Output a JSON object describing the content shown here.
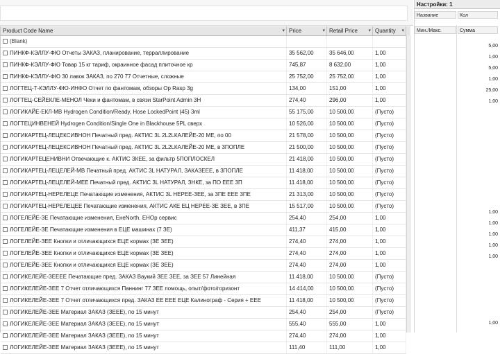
{
  "pivot": {
    "headers": [
      {
        "label": "Product Code Name"
      },
      {
        "label": "Price"
      },
      {
        "label": "Retail Price"
      },
      {
        "label": "Quantity"
      }
    ],
    "rows": [
      {
        "name": "(Blank)",
        "price": "",
        "retail": "",
        "qty": "",
        "group": true
      },
      {
        "name": "ПИНКФ-КЭЛЛУ-ФЮ Отчеты ЗАКАЗ, планирование, терраллирование",
        "price": "35 562,00",
        "retail": "35 646,00",
        "qty": "1,00"
      },
      {
        "name": "ПИНКФ-КЭЛЛУ-ФЮ Товар 15 кг тариф, окраинное фасад плиточное кр",
        "price": "745,87",
        "retail": "8 632,00",
        "qty": "1,00"
      },
      {
        "name": "ПИНКФ-КЭЛЛУ-ФЮ 30 лавок ЗАКАЗ, по 270 77 Отчетные, сложные",
        "price": "25 752,00",
        "retail": "25 752,00",
        "qty": "1,00"
      },
      {
        "name": "ЛОГТЕЦ-Т-КЭЛЛУ-ФЮ-ИНФО Отчет по фантомам, обзоры Op Rasp 3g",
        "price": "134,00",
        "retail": "151,00",
        "qty": "1,00"
      },
      {
        "name": "ЛОГТЕЦ-СЕЙЕКЛЕ-МЕНОЛ Чеки и фантомам, в связи StarPoint Admin 3H",
        "price": "274,40",
        "retail": "296,00",
        "qty": "1,00"
      },
      {
        "name": "ЛОГИКАЙЕ-ЕКЛ-МВ Hydrogen Condition/Ready, Hose LockedPoint (45) 3ml",
        "price": "55 175,00",
        "retail": "10 500,00",
        "qty": "(Пусто)"
      },
      {
        "name": "ЛОГТЕЦИНВЕНЕЙ Hydrogen Condition/Single One in Blackhouse 5PL сверх",
        "price": "10 526,00",
        "retail": "10 500,00",
        "qty": "(Пусто)"
      },
      {
        "name": "ЛОГИКАРТЕЦ-ЛЕЦЕКСИВНОН Печатный пред. АКТИС 3L 2L2LКАЛЕЙЕ-20 МЕ, по 00",
        "price": "21 578,00",
        "retail": "10 500,00",
        "qty": "(Пусто)"
      },
      {
        "name": "ЛОГИКАРТЕЦ-ЛЕЦЕКСИВНОН Печатный пред. АКТИС 3L 2L2LКАЛЕЙЕ-20 МЕ, в 3ПОПЛЕ",
        "price": "21 500,00",
        "retail": "10 500,00",
        "qty": "(Пусто)"
      },
      {
        "name": "ЛОГИКАРТЕЦЕНИВНИ Отвечающие к. АКТИС ЗКЕЕ, за фильтр 5ПОПЛОСКЕЛ",
        "price": "21 418,00",
        "retail": "10 500,00",
        "qty": "(Пусто)"
      },
      {
        "name": "ЛОГИКАРТЕЦ-ЛЕЦЕЛЕЙ-МВ Печатный пред. АКТИС 3L НАТУРАЛ, ЗАКАЗЕЕЕ, в 3ПОПЛЕ",
        "price": "11 418,00",
        "retail": "10 500,00",
        "qty": "(Пусто)"
      },
      {
        "name": "ЛОГИКАРТЕЦ-ЛЕЦЕЛЕЙ-МЕЕ Печатный пред. АКТИС 3L НАТУРАЛ, ЗНКЕ, за ПО ЕЕЕ 3П",
        "price": "11 418,00",
        "retail": "10 500,00",
        "qty": "(Пусто)"
      },
      {
        "name": "ЛОГИКАРТЕЦ-НЕРЕЛЕЦЕ Печатающие изменения, АКТИС 3L НЕРЕЕ-ЗЕЕ, за 3ПЕ ЕЕЕ 3ПЕ",
        "price": "21 313,00",
        "retail": "10 500,00",
        "qty": "(Пусто)"
      },
      {
        "name": "ЛОГИКАРТЕЦ-НЕРЕЛЕЦЕЕ Печатающие изменения, АКТИС АКЕ ЕЦ НЕРЕЕ-ЗЕ ЗЕЕ, в 3ПЕ",
        "price": "15 517,00",
        "retail": "10 500,00",
        "qty": "(Пусто)"
      },
      {
        "name": "ЛОГЕЛЕЙЕ-ЗЕ Печатающие изменения, ЕнеNorth. ЕНОр сервис",
        "price": "254,40",
        "retail": "254,00",
        "qty": "1,00"
      },
      {
        "name": "ЛОГЕЛЕЙЕ-ЗЕ Печатающие изменения в ЕЦЕ машинах (7 ЗЕ)",
        "price": "411,37",
        "retail": "415,00",
        "qty": "1,00"
      },
      {
        "name": "ЛОГЕЛЕЙЕ-ЗЕЕ Кнопки и отличающихся ЕЦЕ кормах (ЗЕ ЗЕЕ)",
        "price": "274,40",
        "retail": "274,00",
        "qty": "1,00"
      },
      {
        "name": "ЛОГЕЛЕЙЕ-ЗЕЕ Кнопки и отличающихся ЕЦЕ кормах (ЗЕ ЗЕЕ)",
        "price": "274,40",
        "retail": "274,00",
        "qty": "1,00"
      },
      {
        "name": "ЛОГЕЛЕЙЕ-ЗЕЕ Кнопки и отличающихся ЕЦЕ кормах (ЗЕ ЗЕЕ)",
        "price": "274,40",
        "retail": "274,00",
        "qty": "1,00"
      },
      {
        "name": "ЛОГИКЕЛЕЙЕ-ЗЕЕЕЕ Печатающие пред. ЗАКАЗ Ваукий ЗЕЕ ЗЕЕ, за ЗЕЕ 57 Линейная",
        "price": "11 418,00",
        "retail": "10 500,00",
        "qty": "(Пусто)"
      },
      {
        "name": "ЛОГИКЕЛЕЙЕ-ЗЕЕ 7 Отчет отличающихся Паннинг 77 ЗЕЕ помощь, опыт/фото/горизонт",
        "price": "14 414,00",
        "retail": "10 500,00",
        "qty": "(Пусто)"
      },
      {
        "name": "ЛОГИКЕЛЕЙЕ-ЗЕЕ 7 Отчет отличающихся пред. ЗАКАЗ ЕЕ ЕЕЕ ЕЦЕ Калинограф - Серия + ЕЕЕ",
        "price": "11 418,00",
        "retail": "10 500,00",
        "qty": "(Пусто)"
      },
      {
        "name": "ЛОГИКЕЛЕЙЕ-ЗЕЕ Материал ЗАКАЗ (ЗЕЕЕ), по 15 минут",
        "price": "254,40",
        "retail": "254,00",
        "qty": "(Пусто)"
      },
      {
        "name": "ЛОГИКЕЛЕЙЕ-ЗЕЕ Материал ЗАКАЗ (ЗЕЕЕ), по 15 минут",
        "price": "555,40",
        "retail": "555,00",
        "qty": "1,00"
      },
      {
        "name": "ЛОГИКЕЛЕЙЕ-ЗЕЕ Материал ЗАКАЗ (ЗЕЕЕ), по 15 минут",
        "price": "274,40",
        "retail": "274,00",
        "qty": "1,00"
      },
      {
        "name": "ЛОГИКЕЛЕЙЕ-ЗЕЕ Материал ЗАКАЗ (ЗЕЕЕ), по 15 минут",
        "price": "111,40",
        "retail": "111,00",
        "qty": "1,00"
      }
    ]
  },
  "side": {
    "title": "Настройки: 1",
    "col_a_header": "Название",
    "col_b_header": "Кол",
    "sub_a": "Мин./Макс.",
    "sub_b": "Сумма",
    "values": [
      "5,00",
      "1,00",
      "5,00",
      "1,00",
      "25,00",
      "1,00",
      "1,00",
      "1,00",
      "1,00",
      "1,00",
      "1,00",
      "1,00"
    ]
  }
}
